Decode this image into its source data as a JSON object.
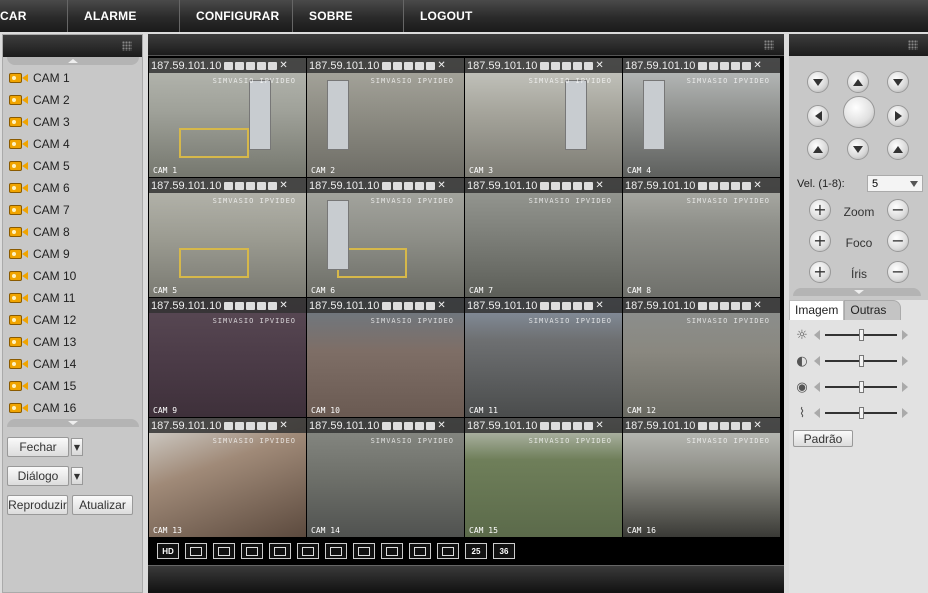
{
  "nav": {
    "items": [
      {
        "label": "CAR"
      },
      {
        "label": "ALARME"
      },
      {
        "label": "CONFIGURAR"
      },
      {
        "label": "SOBRE"
      },
      {
        "label": "LOGOUT"
      }
    ]
  },
  "cameras": [
    {
      "label": "CAM 1"
    },
    {
      "label": "CAM 2"
    },
    {
      "label": "CAM 3"
    },
    {
      "label": "CAM 4"
    },
    {
      "label": "CAM 5"
    },
    {
      "label": "CAM 6"
    },
    {
      "label": "CAM 7"
    },
    {
      "label": "CAM 8"
    },
    {
      "label": "CAM 9"
    },
    {
      "label": "CAM 10"
    },
    {
      "label": "CAM 11"
    },
    {
      "label": "CAM 12"
    },
    {
      "label": "CAM 13"
    },
    {
      "label": "CAM 14"
    },
    {
      "label": "CAM 15"
    },
    {
      "label": "CAM 16"
    }
  ],
  "left_controls": {
    "close_label": "Fechar",
    "dialog_label": "Diálogo",
    "play_label": "Reproduzir",
    "refresh_label": "Atualizar"
  },
  "tiles": [
    {
      "ip": "187.59.101.10",
      "cam": "CAM 1",
      "wm": "SIMVASIO IPVIDEO",
      "selected": true
    },
    {
      "ip": "187.59.101.10",
      "cam": "CAM 2",
      "wm": "SIMVASIO IPVIDEO"
    },
    {
      "ip": "187.59.101.10",
      "cam": "CAM 3",
      "wm": "SIMVASIO IPVIDEO"
    },
    {
      "ip": "187.59.101.10",
      "cam": "CAM 4",
      "wm": "SIMVASIO IPVIDEO"
    },
    {
      "ip": "187.59.101.10",
      "cam": "CAM 5",
      "wm": "SIMVASIO IPVIDEO"
    },
    {
      "ip": "187.59.101.10",
      "cam": "CAM 6",
      "wm": "SIMVASIO IPVIDEO"
    },
    {
      "ip": "187.59.101.10",
      "cam": "CAM 7",
      "wm": "SIMVASIO IPVIDEO"
    },
    {
      "ip": "187.59.101.10",
      "cam": "CAM 8",
      "wm": "SIMVASIO IPVIDEO"
    },
    {
      "ip": "187.59.101.10",
      "cam": "CAM 9",
      "wm": "SIMVASIO IPVIDEO"
    },
    {
      "ip": "187.59.101.10",
      "cam": "CAM 10",
      "wm": "SIMVASIO IPVIDEO"
    },
    {
      "ip": "187.59.101.10",
      "cam": "CAM 11",
      "wm": "SIMVASIO IPVIDEO"
    },
    {
      "ip": "187.59.101.10",
      "cam": "CAM 12",
      "wm": "SIMVASIO IPVIDEO"
    },
    {
      "ip": "187.59.101.10",
      "cam": "CAM 13",
      "wm": "SIMVASIO IPVIDEO"
    },
    {
      "ip": "187.59.101.10",
      "cam": "CAM 14",
      "wm": "SIMVASIO IPVIDEO"
    },
    {
      "ip": "187.59.101.10",
      "cam": "CAM 15",
      "wm": "SIMVASIO IPVIDEO"
    },
    {
      "ip": "187.59.101.10",
      "cam": "CAM 16",
      "wm": "SIMVASIO IPVIDEO"
    }
  ],
  "layout_buttons": [
    {
      "label": "HD"
    },
    {
      "label": ""
    },
    {
      "label": ""
    },
    {
      "label": ""
    },
    {
      "label": ""
    },
    {
      "label": ""
    },
    {
      "label": ""
    },
    {
      "label": ""
    },
    {
      "label": ""
    },
    {
      "label": ""
    },
    {
      "label": ""
    },
    {
      "label": "25"
    },
    {
      "label": "36"
    }
  ],
  "ptz": {
    "speed_label": "Vel. (1-8):",
    "speed_value": "5",
    "zoom_label": "Zoom",
    "focus_label": "Foco",
    "iris_label": "Íris"
  },
  "image_panel": {
    "tab_image": "Imagem",
    "tab_other": "Outras",
    "sliders": [
      {
        "icon": "brightness-icon",
        "level": 0.5
      },
      {
        "icon": "contrast-icon",
        "level": 0.5
      },
      {
        "icon": "saturation-icon",
        "level": 0.5
      },
      {
        "icon": "hue-icon",
        "level": 0.5
      }
    ],
    "default_label": "Padrão"
  },
  "colors": {
    "selected_outline": "#3c8e3c",
    "cam_icon": "#f0a400"
  }
}
